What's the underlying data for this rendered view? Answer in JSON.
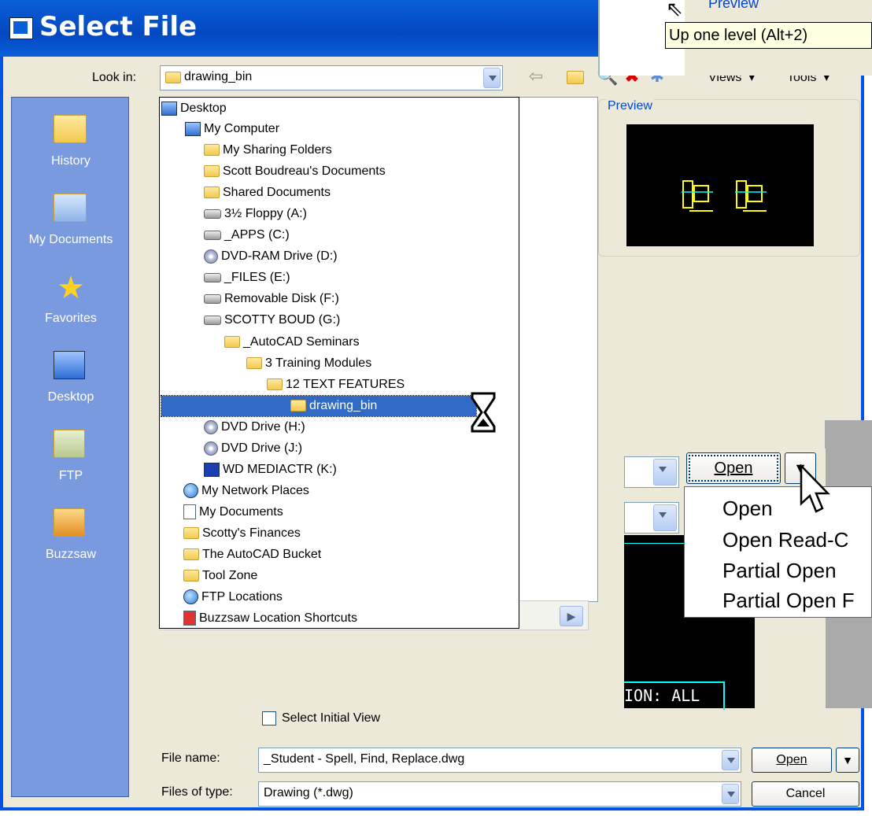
{
  "dialog": {
    "title": "Select File"
  },
  "look_in": {
    "label": "Look in:",
    "value": "drawing_bin"
  },
  "toolbar": {
    "views_label": "Views",
    "tools_label": "Tools"
  },
  "places": [
    {
      "label": "History",
      "icon": "folder-history-icon"
    },
    {
      "label": "My Documents",
      "icon": "my-documents-icon"
    },
    {
      "label": "Favorites",
      "icon": "favorites-star-icon"
    },
    {
      "label": "Desktop",
      "icon": "desktop-icon"
    },
    {
      "label": "FTP",
      "icon": "ftp-icon"
    },
    {
      "label": "Buzzsaw",
      "icon": "buzzsaw-icon"
    }
  ],
  "dropdown_items": [
    {
      "label": "Desktop",
      "indent": 0,
      "icon": "desktop"
    },
    {
      "label": "My Computer",
      "indent": 1,
      "icon": "computer"
    },
    {
      "label": "My Sharing Folders",
      "indent": 2,
      "icon": "shared-folder"
    },
    {
      "label": "Scott Boudreau's Documents",
      "indent": 2,
      "icon": "folder"
    },
    {
      "label": "Shared Documents",
      "indent": 2,
      "icon": "folder"
    },
    {
      "label": "3½ Floppy (A:)",
      "indent": 2,
      "icon": "floppy"
    },
    {
      "label": "_APPS (C:)",
      "indent": 2,
      "icon": "drive"
    },
    {
      "label": "DVD-RAM Drive (D:)",
      "indent": 2,
      "icon": "disc"
    },
    {
      "label": "_FILES (E:)",
      "indent": 2,
      "icon": "drive"
    },
    {
      "label": "Removable Disk (F:)",
      "indent": 2,
      "icon": "drive"
    },
    {
      "label": "SCOTTY BOUD (G:)",
      "indent": 2,
      "icon": "drive"
    },
    {
      "label": "_AutoCAD Seminars",
      "indent": 3,
      "icon": "folder"
    },
    {
      "label": "3 Training Modules",
      "indent": 4,
      "icon": "folder"
    },
    {
      "label": "12 TEXT FEATURES",
      "indent": 5,
      "icon": "folder"
    },
    {
      "label": "drawing_bin",
      "indent": 6,
      "icon": "folder",
      "selected": true
    },
    {
      "label": "DVD Drive (H:)",
      "indent": 2,
      "icon": "disc"
    },
    {
      "label": "DVD Drive (J:)",
      "indent": 2,
      "icon": "disc"
    },
    {
      "label": "WD MEDIACTR (K:)",
      "indent": 2,
      "icon": "drive"
    },
    {
      "label": "My Network Places",
      "indent": 1,
      "icon": "globe"
    },
    {
      "label": "My Documents",
      "indent": 1,
      "icon": "doc"
    },
    {
      "label": "Scotty's Finances",
      "indent": 1,
      "icon": "folder"
    },
    {
      "label": "The AutoCAD Bucket",
      "indent": 1,
      "icon": "folder"
    },
    {
      "label": "Tool Zone",
      "indent": 1,
      "icon": "folder"
    },
    {
      "label": "FTP Locations",
      "indent": 1,
      "icon": "globe"
    },
    {
      "label": "Buzzsaw Location Shortcuts",
      "indent": 1,
      "icon": "doc"
    }
  ],
  "preview": {
    "label": "Preview"
  },
  "select_initial_view": {
    "label": "Select Initial View",
    "checked": false
  },
  "file_name": {
    "label": "File name:",
    "value": "_Student - Spell, Find, Replace.dwg"
  },
  "files_of_type": {
    "label": "Files of type:",
    "value": "Drawing (*.dwg)"
  },
  "buttons": {
    "open": "Open",
    "cancel": "Cancel"
  },
  "inset": {
    "tooltip": "Up one level (Alt+2)",
    "preview_label": "Preview",
    "open_button": "Open",
    "menu": [
      "Open",
      "Open Read-C",
      "Partial Open",
      "Partial Open F"
    ],
    "cad_text": "ION: ALL"
  }
}
